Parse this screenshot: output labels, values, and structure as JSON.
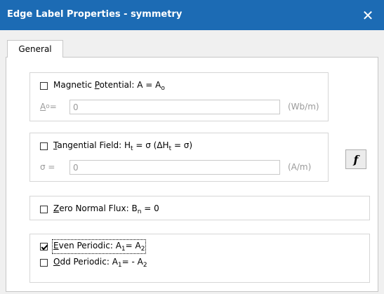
{
  "window": {
    "title": "Edge Label Properties - symmetry",
    "close_glyph": "✕"
  },
  "tabs": [
    {
      "label": "General",
      "selected": true
    }
  ],
  "magnetic_potential": {
    "checked": false,
    "label_pre": "Magnetic ",
    "label_hotkey": "P",
    "label_post": "otential: A = A",
    "label_sub": "o",
    "field_label_hotkey": "A",
    "field_label_sub": "o",
    "field_label_post": " =",
    "value": "0",
    "unit": "(Wb/m)"
  },
  "function_button": {
    "label": "f"
  },
  "tangential_field": {
    "checked": false,
    "label_hotkey": "T",
    "label_a": "angential Field: H",
    "label_sub1": "t",
    "label_b": " = σ (ΔH",
    "label_sub2": "t",
    "label_c": " = σ)",
    "field_label": "σ =",
    "value": "0",
    "unit": "(A/m)"
  },
  "zero_normal_flux": {
    "checked": false,
    "label_hotkey": "Z",
    "label_a": "ero Normal Flux: B",
    "label_sub": "n",
    "label_b": " = 0"
  },
  "even_periodic": {
    "checked": true,
    "label_hotkey": "E",
    "label_a": "ven Periodic: A",
    "label_sub1": "1",
    "label_b": "= A",
    "label_sub2": "2"
  },
  "odd_periodic": {
    "checked": false,
    "label_hotkey": "O",
    "label_a": "dd Periodic: A",
    "label_sub1": "1",
    "label_b": "= - A",
    "label_sub2": "2"
  }
}
